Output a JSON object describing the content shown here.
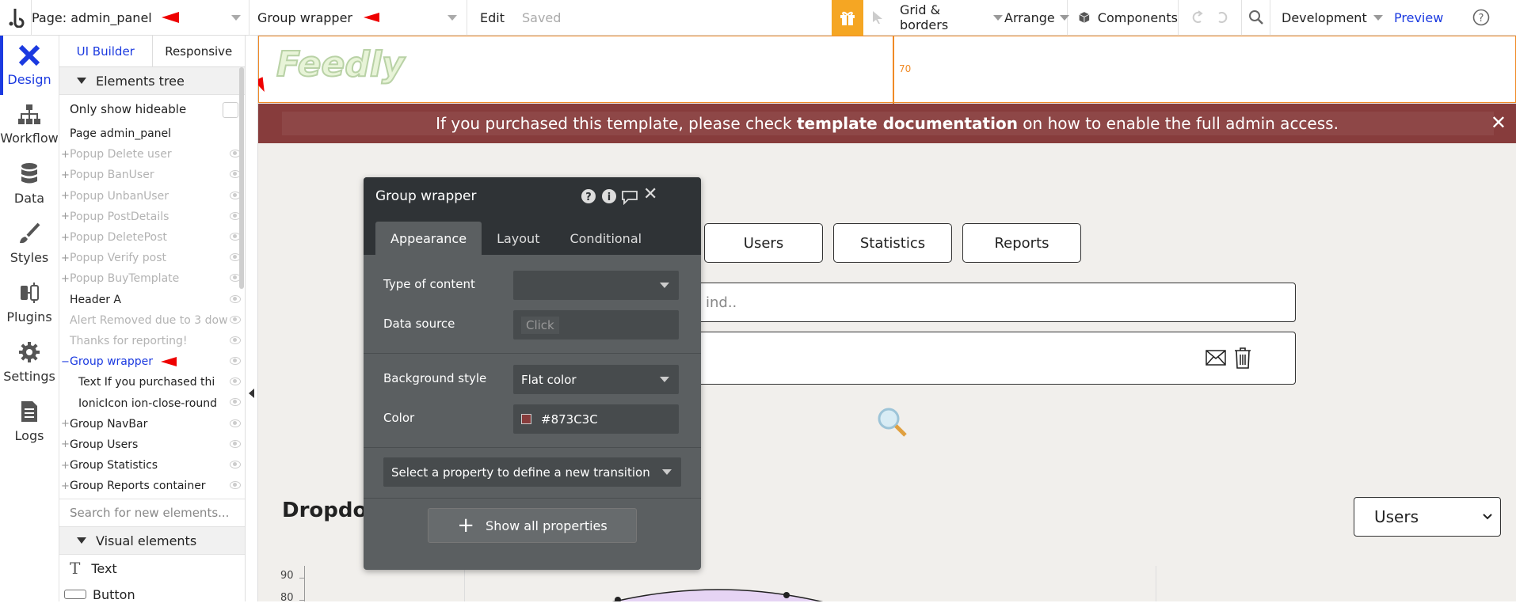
{
  "topbar": {
    "page_label": "Page: admin_panel",
    "element_label": "Group wrapper",
    "edit": "Edit",
    "saved": "Saved",
    "grid_borders": "Grid & borders",
    "arrange": "Arrange",
    "components": "Components",
    "development": "Development",
    "preview": "Preview"
  },
  "leftnav": [
    {
      "label": "Design",
      "icon": "design-icon"
    },
    {
      "label": "Workflow",
      "icon": "workflow-icon"
    },
    {
      "label": "Data",
      "icon": "data-icon"
    },
    {
      "label": "Styles",
      "icon": "styles-icon"
    },
    {
      "label": "Plugins",
      "icon": "plugins-icon"
    },
    {
      "label": "Settings",
      "icon": "settings-icon"
    },
    {
      "label": "Logs",
      "icon": "logs-icon"
    }
  ],
  "tree": {
    "tab_ui": "UI Builder",
    "tab_responsive": "Responsive",
    "elements_tree": "Elements tree",
    "only_show_hideable": "Only show hideable",
    "search_placeholder": "Search for new elements...",
    "visual_elements": "Visual elements",
    "items": [
      "Page admin_panel",
      "Popup Delete user",
      "Popup BanUser",
      "Popup UnbanUser",
      "Popup PostDetails",
      "Popup DeletePost",
      "Popup Verify post",
      "Popup BuyTemplate",
      "Header A",
      "Alert Removed due to 3 dow",
      "Thanks for reporting!",
      "Group wrapper",
      "Text If you purchased thi",
      "IonicIcon ion-close-round",
      "Group NavBar",
      "Group Users",
      "Group Statistics",
      "Group Reports container"
    ],
    "visual": [
      {
        "label": "Text",
        "icon": "text-icon"
      },
      {
        "label": "Button",
        "icon": "button-icon"
      }
    ]
  },
  "canvas": {
    "logo": "Feedly",
    "ruler_value": "70",
    "alert_pre": "If you purchased this template, please check ",
    "alert_bold": "template documentation",
    "alert_post": " on how to enable the full admin access.",
    "tab_users": "Users",
    "tab_statistics": "Statistics",
    "tab_reports": "Reports",
    "search_text": "ind..",
    "dropdown_heading": "Dropdov",
    "select_value": "Users",
    "y_ticks": [
      "90",
      "80"
    ]
  },
  "popup": {
    "title": "Group wrapper",
    "tabs": [
      "Appearance",
      "Layout",
      "Conditional"
    ],
    "type_of_content": "Type of content",
    "data_source": "Data source",
    "data_source_value": "Click",
    "background_style": "Background style",
    "background_value": "Flat color",
    "color": "Color",
    "color_value": "#873C3C",
    "transition": "Select a property to define a new transition",
    "show_all": "Show all properties"
  },
  "colors": {
    "accent": "#1b3ae0",
    "alert_bg": "#873c3c",
    "gift": "#f5a623"
  }
}
